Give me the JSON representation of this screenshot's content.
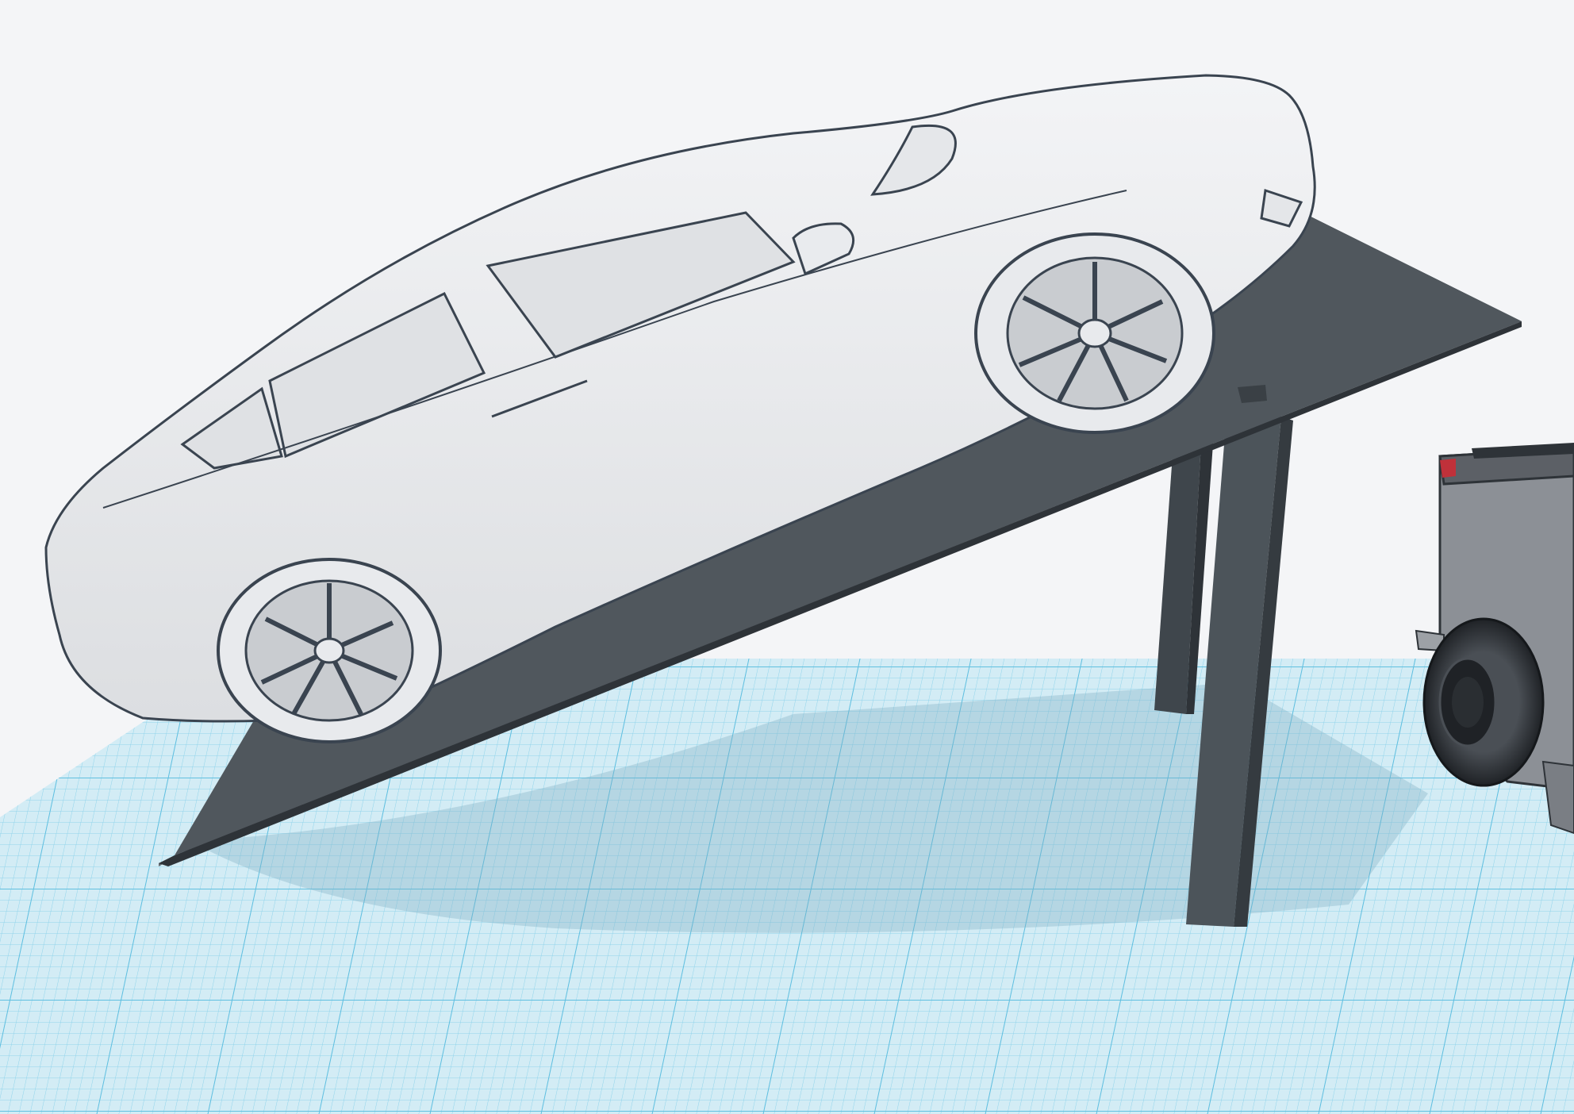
{
  "viewport": {
    "background": "#f4f5f7",
    "workplane_color": "#d3ecf5",
    "grid_minor_color": "#8fd3ea",
    "grid_major_color": "#5fbfe0"
  },
  "objects": [
    {
      "name": "sedan-car-model",
      "color": "#eeeff1",
      "outline": "#3a4450"
    },
    {
      "name": "tilted-ramp-platform",
      "color": "#50575d"
    },
    {
      "name": "ramp-support-post",
      "color": "#4c545a"
    },
    {
      "name": "pickup-truck-model",
      "color": "#8c9096"
    }
  ]
}
